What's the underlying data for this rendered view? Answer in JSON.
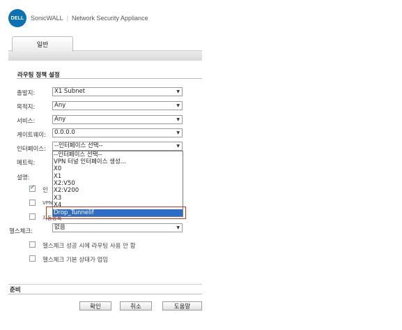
{
  "header": {
    "logo_text": "DELL",
    "brand": "SonicWALL",
    "product": "Network Security Appliance"
  },
  "tab": {
    "label": "일반"
  },
  "section": {
    "title": "라우팅 정책 설정"
  },
  "form": {
    "source_label": "출발지:",
    "source_value": "X1 Subnet",
    "destination_label": "목적지:",
    "destination_value": "Any",
    "service_label": "서비스:",
    "service_value": "Any",
    "gateway_label": "게이트웨이:",
    "gateway_value": "0.0.0.0",
    "interface_label": "인터페이스:",
    "interface_value": "--인터페이스 선택--",
    "metric_label": "메트릭:",
    "settings_label": "설명:",
    "healthcheck_label": "헬스체크:",
    "healthcheck_value": "없음"
  },
  "dropdown": {
    "options": [
      "--인터페이스 선택--",
      "VPN 터널 인터페이스 생성...",
      "X0",
      "X1",
      "X2:V50",
      "X2:V200",
      "X3",
      "X4",
      "Drop_Tunnelif"
    ],
    "selected_index": 8
  },
  "checkboxes": [
    {
      "label": "인",
      "checked": true
    },
    {
      "label": "VPN",
      "checked": false
    },
    {
      "label": "자동등록",
      "checked": false
    }
  ],
  "health_options": [
    {
      "label": "헬스체크 성공 시에 라우팅 사용 안 함",
      "checked": false
    },
    {
      "label": "헬스체크 기본 상태가 업임",
      "checked": false
    }
  ],
  "footer": {
    "title": "준비",
    "ok": "확인",
    "cancel": "취소",
    "help": "도움말"
  }
}
